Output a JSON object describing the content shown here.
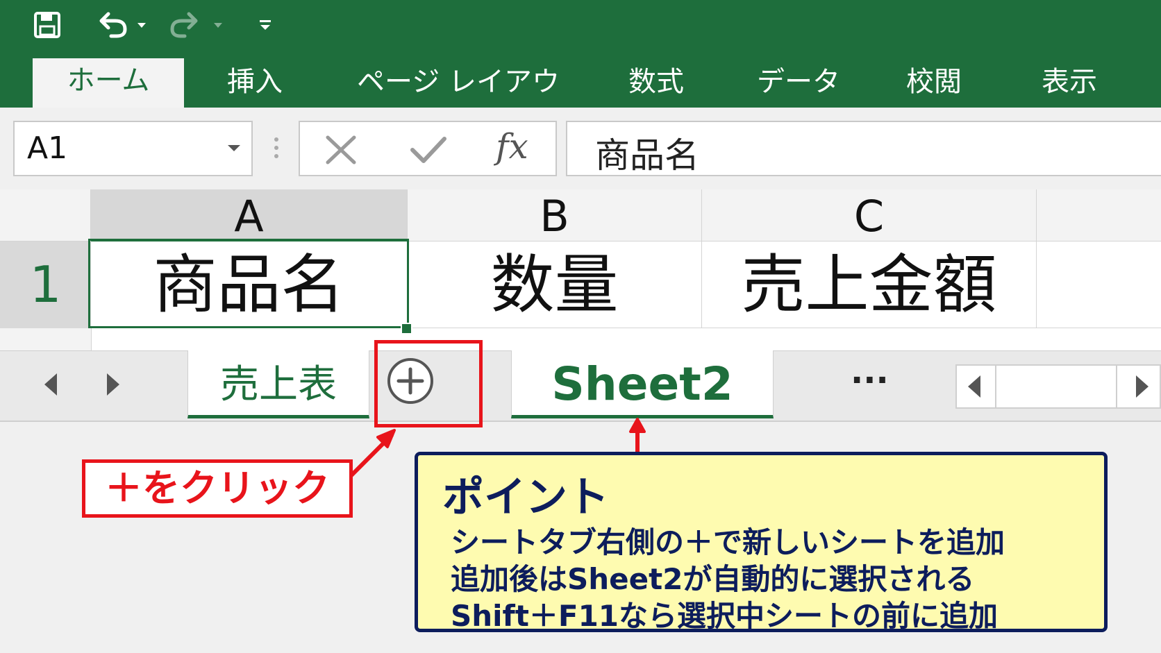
{
  "quick_access": {
    "icons": [
      "save-icon",
      "undo-icon",
      "redo-icon",
      "customize-icon"
    ],
    "colors": {
      "ribbon": "#1e6e3c",
      "highlight": "#e8141b",
      "note_bg": "#fefbb0",
      "note_border": "#0d1d5c"
    }
  },
  "ribbon": {
    "tabs": [
      {
        "label": "ホーム",
        "active": true
      },
      {
        "label": "挿入"
      },
      {
        "label": "ページ レイアウト"
      },
      {
        "label": "数式"
      },
      {
        "label": "データ"
      },
      {
        "label": "校閲"
      },
      {
        "label": "表示"
      }
    ]
  },
  "formula_bar": {
    "name_box": "A1",
    "fx_label": "fx",
    "formula": "商品名"
  },
  "grid": {
    "columns": [
      "A",
      "B",
      "C"
    ],
    "rows": [
      {
        "number": "1",
        "cells": [
          "商品名",
          "数量",
          "売上金額"
        ]
      }
    ],
    "selected_cell": "A1"
  },
  "sheet_tabs": {
    "tabs": [
      "売上表",
      "Sheet2"
    ],
    "active": "Sheet2",
    "new_sheet_symbol": "+",
    "more_label": "···"
  },
  "annotations": {
    "click_label": "＋をクリック",
    "point": {
      "title": "ポイント",
      "lines": [
        "シートタブ右側の＋で新しいシートを追加",
        "追加後はSheet2が自動的に選択される",
        "Shift＋F11なら選択中シートの前に追加"
      ]
    }
  }
}
